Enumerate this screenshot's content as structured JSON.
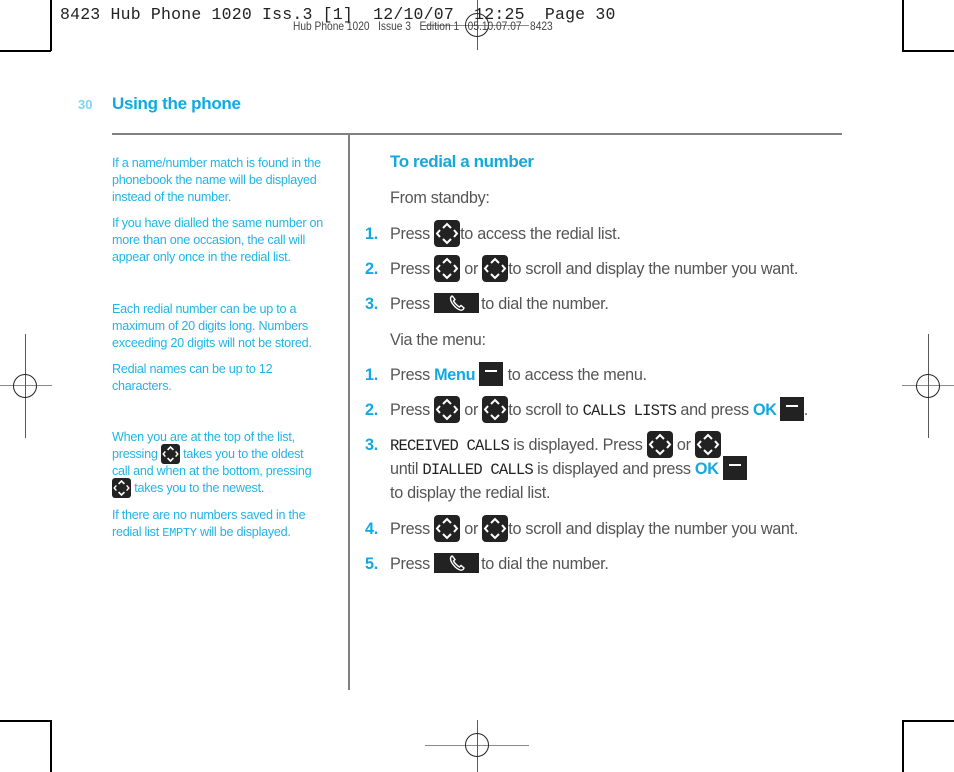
{
  "slug": {
    "print_header": "8423 Hub Phone 1020 Iss.3 [1]  12/10/07  12:25  Page 30",
    "overlap_header": "Hub Phone 1020   Issue 3   Edition 1   05.10.07.07   8423"
  },
  "page": {
    "number": "30",
    "section_title": "Using the phone"
  },
  "sidebar": {
    "notes": [
      "If a name/number match is found in the phonebook the name will be displayed instead of the number.",
      "If you have dialled the same number on more than one occasion, the call will appear only once in the redial list.",
      "Each redial number can be up to a maximum of 20 digits long. Numbers exceeding 20 digits will not be stored.",
      "Redial names can be up to 12 characters."
    ],
    "scroll_note": {
      "part1": "When you are at the top of the list,",
      "part2": "pressing",
      "part3": "takes you to the oldest",
      "part4": "call and when at the bottom, pressing",
      "part5": "takes you to the newest."
    },
    "empty_note": {
      "before": "If there are no numbers saved in the",
      "before2": "redial list",
      "lcd": "EMPTY",
      "after": "will be displayed."
    }
  },
  "main": {
    "title": "To redial a number",
    "from_standby_label": "From standby:",
    "standby_steps": [
      {
        "n": "1.",
        "press": "Press",
        "rest": "to access the redial list."
      },
      {
        "n": "2.",
        "press": "Press",
        "or": "or",
        "rest": "to scroll and display the number you want."
      },
      {
        "n": "3.",
        "press": "Press",
        "rest": "to dial the number."
      }
    ],
    "via_menu_label": "Via the menu:",
    "menu_steps": {
      "s1": {
        "n": "1.",
        "press": "Press",
        "kw": "Menu",
        "rest": "to access the menu."
      },
      "s2": {
        "n": "2.",
        "press": "Press",
        "or": "or",
        "mid": "to scroll to",
        "lcd": "CALLS LISTS",
        "and": "and press",
        "kw": "OK",
        "end": "."
      },
      "s3": {
        "n": "3.",
        "lcd1": "RECEIVED CALLS",
        "mid": "is displayed. Press",
        "or": "or",
        "until": "until",
        "lcd2": "DIALLED CALLS",
        "mid2": "is displayed and press",
        "kw": "OK",
        "line3": "to display the redial list."
      },
      "s4": {
        "n": "4.",
        "press": "Press",
        "or": "or",
        "rest": "to scroll and display the number you want."
      },
      "s5": {
        "n": "5.",
        "press": "Press",
        "rest": "to dial the number."
      }
    }
  },
  "icons": {
    "nav": "navigation-key-icon",
    "call": "talk-key-icon",
    "soft": "softkey-icon"
  },
  "colors": {
    "accent": "#12a8e0",
    "note_text": "#22b4e6",
    "body_text": "#555555",
    "rule": "#808080"
  }
}
